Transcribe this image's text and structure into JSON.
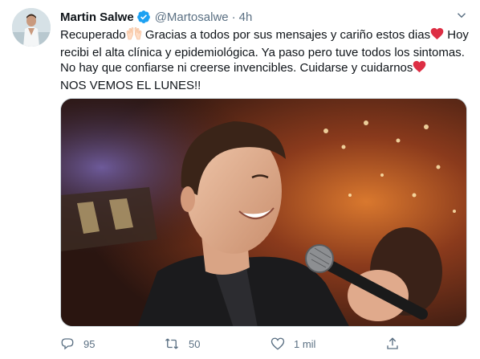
{
  "tweet": {
    "author_name": "Martin Salwe",
    "handle": "@Martosalwe",
    "separator": "·",
    "time": "4h",
    "lines": {
      "l1a": "Recuperado",
      "l1b": " Gracias a todos por sus mensajes y cariño estos dias",
      "l1c": " Hoy",
      "l2": "recibi el alta clínica y epidemiológica. Ya paso pero tuve todos los sintomas.",
      "l3": "No hay que confiarse ni creerse invencibles. Cuidarse y cuidarnos",
      "l4": "NOS VEMOS EL LUNES!!"
    },
    "emojis": [
      "raising-hands-emoji",
      "red-heart-emoji",
      "red-heart-emoji"
    ]
  },
  "actions": {
    "reply_count": "95",
    "retweet_count": "50",
    "like_count": "1 mil",
    "share_count": ""
  },
  "colors": {
    "text": "#0f1419",
    "secondary": "#5b7083",
    "verified": "#1da1f2",
    "heart": "#dd2e44",
    "border": "#cfd9de"
  },
  "icons": {
    "verified": "verified-badge-icon",
    "caret": "chevron-down-icon",
    "reply": "reply-icon",
    "retweet": "retweet-icon",
    "like": "heart-outline-icon",
    "share": "share-icon"
  }
}
